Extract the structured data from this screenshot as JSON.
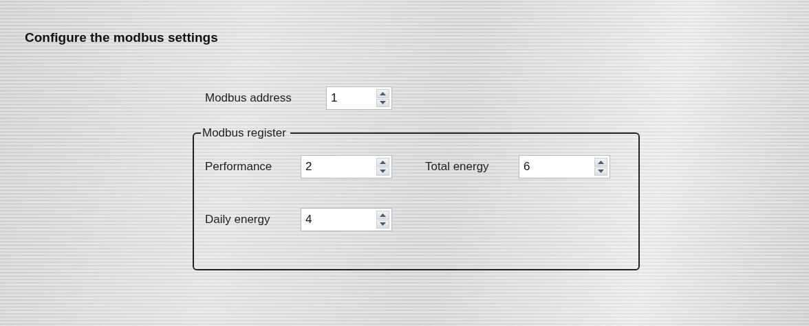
{
  "heading": "Configure the modbus settings",
  "address": {
    "label": "Modbus address",
    "value": "1"
  },
  "register_group": {
    "title": "Modbus register",
    "fields": [
      {
        "label": "Performance",
        "value": "2"
      },
      {
        "label": "Total energy",
        "value": "6"
      },
      {
        "label": "Daily energy",
        "value": "4"
      }
    ]
  }
}
